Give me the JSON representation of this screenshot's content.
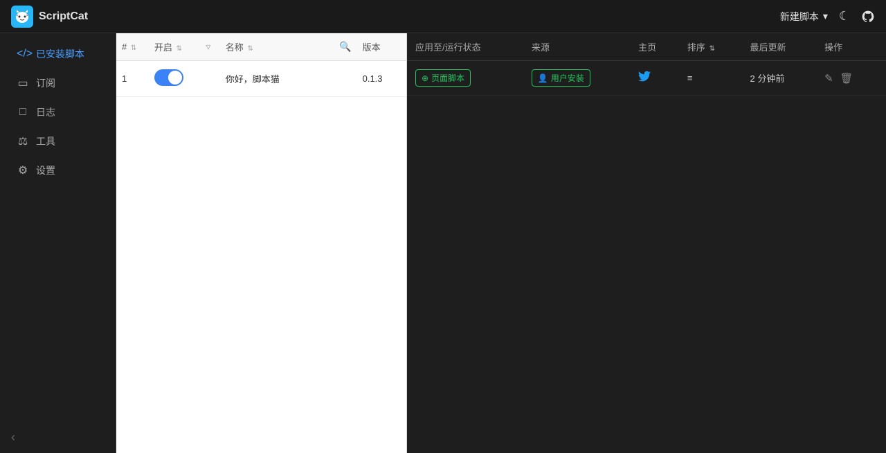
{
  "topbar": {
    "logo_text": "ScriptCat",
    "new_script_label": "新建脚本",
    "chevron_icon": "▾",
    "dark_mode_icon": "☾",
    "github_icon": "github"
  },
  "sidebar": {
    "items": [
      {
        "id": "installed",
        "label": "已安装脚本",
        "icon": "code",
        "active": true
      },
      {
        "id": "subscribe",
        "label": "订阅",
        "icon": "bookmark",
        "active": false
      },
      {
        "id": "logs",
        "label": "日志",
        "icon": "file",
        "active": false
      },
      {
        "id": "tools",
        "label": "工具",
        "icon": "wrench",
        "active": false
      },
      {
        "id": "settings",
        "label": "设置",
        "icon": "gear",
        "active": false
      }
    ],
    "collapse_icon": "‹"
  },
  "left_table": {
    "columns": [
      {
        "id": "num",
        "label": "#",
        "sortable": true
      },
      {
        "id": "toggle",
        "label": "开启",
        "sortable": true
      },
      {
        "id": "filter",
        "label": "",
        "icon": "filter"
      },
      {
        "id": "name",
        "label": "名称",
        "sortable": true
      },
      {
        "id": "search",
        "label": "",
        "icon": "search"
      },
      {
        "id": "version",
        "label": "版本"
      }
    ],
    "rows": [
      {
        "num": "1",
        "enabled": true,
        "name": "你好，脚本猫",
        "version": "0.1.3"
      }
    ]
  },
  "right_table": {
    "columns": [
      {
        "id": "apply",
        "label": "应用至/运行状态"
      },
      {
        "id": "source",
        "label": "来源"
      },
      {
        "id": "home",
        "label": "主页"
      },
      {
        "id": "order",
        "label": "排序",
        "sortable": true
      },
      {
        "id": "updated",
        "label": "最后更新"
      },
      {
        "id": "actions",
        "label": "操作"
      }
    ],
    "rows": [
      {
        "apply_label": "⊕ 页面脚本",
        "source_label": "👤 用户安装",
        "home_icon": "twitter",
        "order_icon": "≡",
        "updated": "2 分钟前",
        "edit_title": "编辑",
        "delete_title": "删除"
      }
    ]
  }
}
